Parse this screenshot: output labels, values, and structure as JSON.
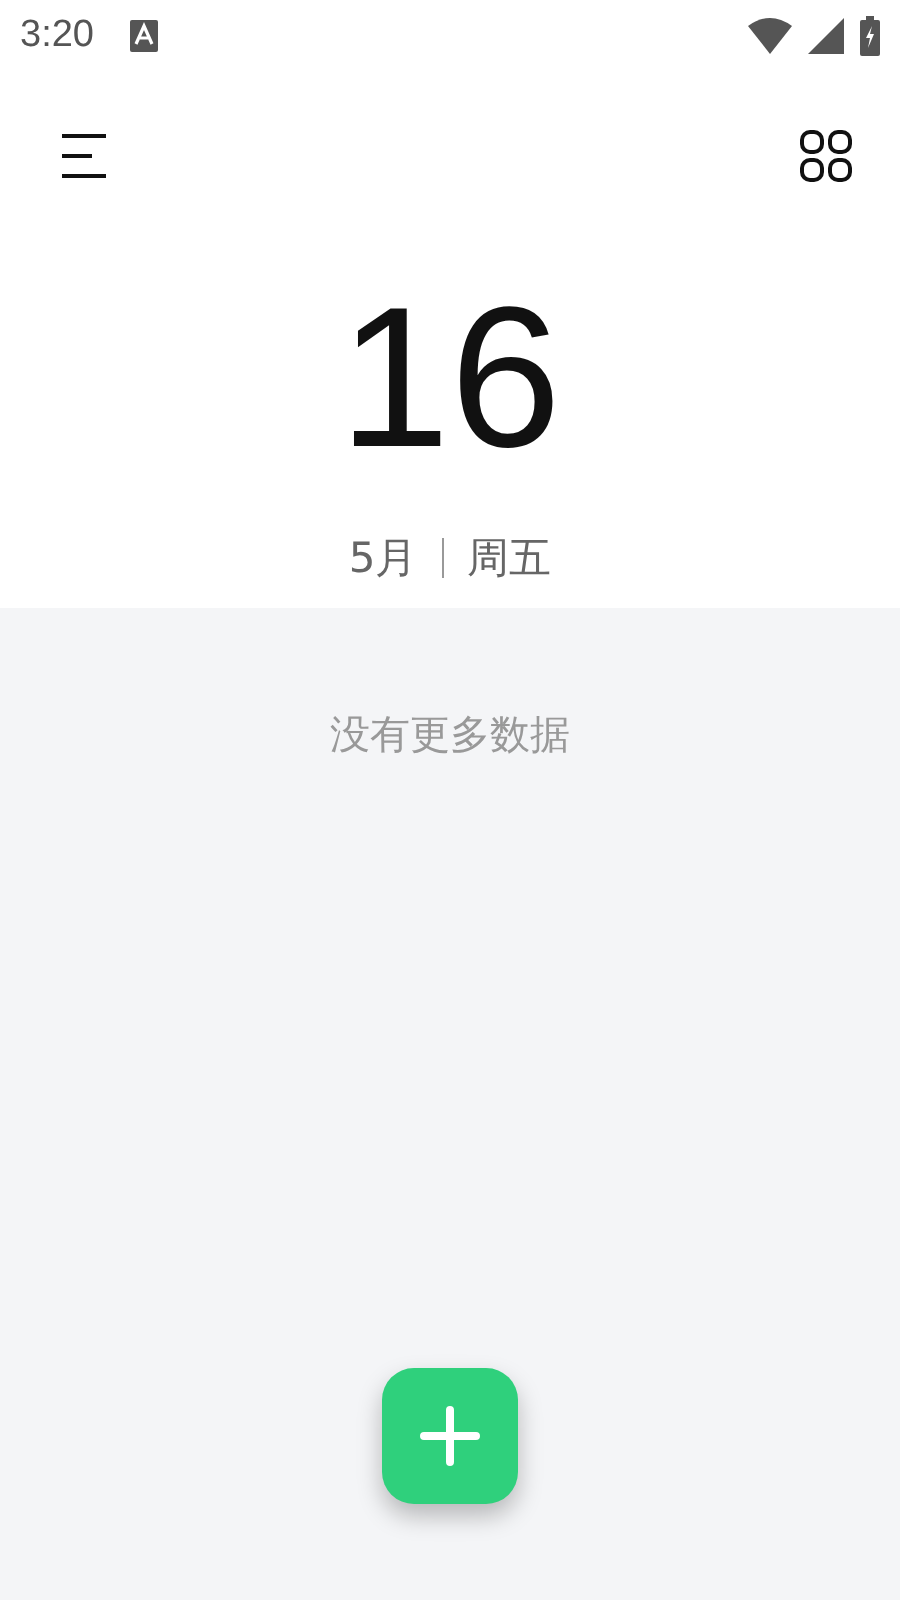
{
  "status_bar": {
    "time": "3:20"
  },
  "date": {
    "day": "16",
    "month": "5月",
    "weekday": "周五"
  },
  "list": {
    "empty_text": "没有更多数据"
  }
}
